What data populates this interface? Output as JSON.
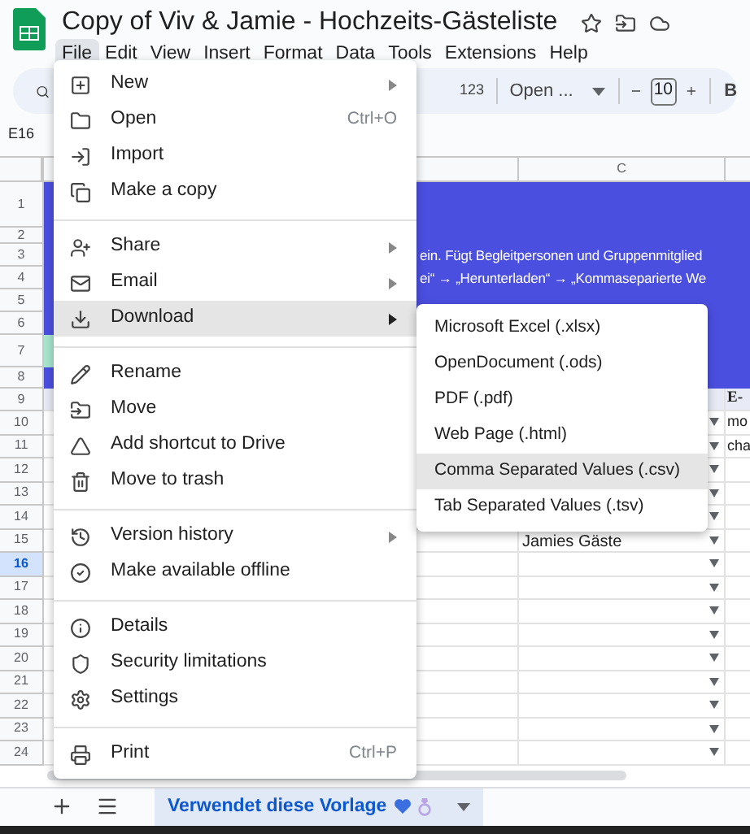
{
  "app": {
    "title": "Copy of Viv & Jamie - Hochzeits-Gästeliste"
  },
  "menubar": [
    {
      "label": "File",
      "selected": true
    },
    {
      "label": "Edit",
      "selected": false
    },
    {
      "label": "View",
      "selected": false
    },
    {
      "label": "Insert",
      "selected": false
    },
    {
      "label": "Format",
      "selected": false
    },
    {
      "label": "Data",
      "selected": false
    },
    {
      "label": "Tools",
      "selected": false
    },
    {
      "label": "Extensions",
      "selected": false
    },
    {
      "label": "Help",
      "selected": false
    }
  ],
  "toolbar": {
    "number_format": "123",
    "font": "Open ...",
    "font_size": "10",
    "bold": "B"
  },
  "name_box": "E16",
  "column_header": "C",
  "rows": [
    {
      "number": "1",
      "kind": "banner",
      "selected": false
    },
    {
      "number": "2",
      "kind": "banner",
      "selected": false
    },
    {
      "number": "3",
      "kind": "banner",
      "selected": false,
      "banner_text": "ein. Fügt Begleitpersonen und Gruppenmitglied"
    },
    {
      "number": "4",
      "kind": "banner",
      "selected": false,
      "banner_text": "ei“ → „Herunterladen“ → „Kommaseparierte We"
    },
    {
      "number": "5",
      "kind": "banner",
      "selected": false
    },
    {
      "number": "6",
      "kind": "banner",
      "selected": false
    },
    {
      "number": "7",
      "kind": "accent",
      "selected": false
    },
    {
      "number": "8",
      "kind": "banner",
      "selected": false
    },
    {
      "number": "9",
      "kind": "header",
      "selected": false,
      "col_d": "E-"
    },
    {
      "number": "10",
      "kind": "data",
      "selected": false,
      "col_d": "mo",
      "dropdown": true
    },
    {
      "number": "11",
      "kind": "data",
      "selected": false,
      "col_d": "cha",
      "dropdown": true
    },
    {
      "number": "12",
      "kind": "data",
      "selected": false,
      "dropdown": true
    },
    {
      "number": "13",
      "kind": "data",
      "selected": false,
      "dropdown": true
    },
    {
      "number": "14",
      "kind": "data",
      "selected": false,
      "dropdown": true
    },
    {
      "number": "15",
      "kind": "data",
      "selected": false,
      "col_c": "Jamies Gäste",
      "dropdown": true
    },
    {
      "number": "16",
      "kind": "data",
      "selected": true,
      "dropdown": true
    },
    {
      "number": "17",
      "kind": "data",
      "selected": false,
      "dropdown": true
    },
    {
      "number": "18",
      "kind": "data",
      "selected": false,
      "dropdown": true
    },
    {
      "number": "19",
      "kind": "data",
      "selected": false,
      "dropdown": true
    },
    {
      "number": "20",
      "kind": "data",
      "selected": false,
      "dropdown": true
    },
    {
      "number": "21",
      "kind": "data",
      "selected": false,
      "dropdown": true
    },
    {
      "number": "22",
      "kind": "data",
      "selected": false,
      "dropdown": true
    },
    {
      "number": "23",
      "kind": "data",
      "selected": false,
      "dropdown": true
    },
    {
      "number": "24",
      "kind": "data",
      "selected": false,
      "dropdown": true
    }
  ],
  "file_menu": {
    "groups": [
      [
        {
          "label": "New",
          "submenu": true,
          "selected": false
        },
        {
          "label": "Open",
          "shortcut": "Ctrl+O",
          "submenu": false,
          "selected": false
        },
        {
          "label": "Import",
          "submenu": false,
          "selected": false
        },
        {
          "label": "Make a copy",
          "submenu": false,
          "selected": false
        }
      ],
      [
        {
          "label": "Share",
          "submenu": true,
          "selected": false
        },
        {
          "label": "Email",
          "submenu": true,
          "selected": false
        },
        {
          "label": "Download",
          "submenu": true,
          "selected": true
        }
      ],
      [
        {
          "label": "Rename",
          "submenu": false,
          "selected": false
        },
        {
          "label": "Move",
          "submenu": false,
          "selected": false
        },
        {
          "label": "Add shortcut to Drive",
          "submenu": false,
          "selected": false
        },
        {
          "label": "Move to trash",
          "submenu": false,
          "selected": false
        }
      ],
      [
        {
          "label": "Version history",
          "submenu": true,
          "selected": false
        },
        {
          "label": "Make available offline",
          "submenu": false,
          "selected": false
        }
      ],
      [
        {
          "label": "Details",
          "submenu": false,
          "selected": false
        },
        {
          "label": "Security limitations",
          "submenu": false,
          "selected": false
        },
        {
          "label": "Settings",
          "submenu": false,
          "selected": false
        }
      ],
      [
        {
          "label": "Print",
          "shortcut": "Ctrl+P",
          "submenu": false,
          "selected": false
        }
      ]
    ]
  },
  "download_submenu": [
    {
      "label": "Microsoft Excel (.xlsx)",
      "selected": false
    },
    {
      "label": "OpenDocument (.ods)",
      "selected": false
    },
    {
      "label": "PDF (.pdf)",
      "selected": false
    },
    {
      "label": "Web Page (.html)",
      "selected": false
    },
    {
      "label": "Comma Separated Values (.csv)",
      "selected": true
    },
    {
      "label": "Tab Separated Values (.tsv)",
      "selected": false
    }
  ],
  "sheet_bar": {
    "tabs": [
      {
        "label": "Verwendet diese Vorlage",
        "selected": true
      }
    ]
  }
}
